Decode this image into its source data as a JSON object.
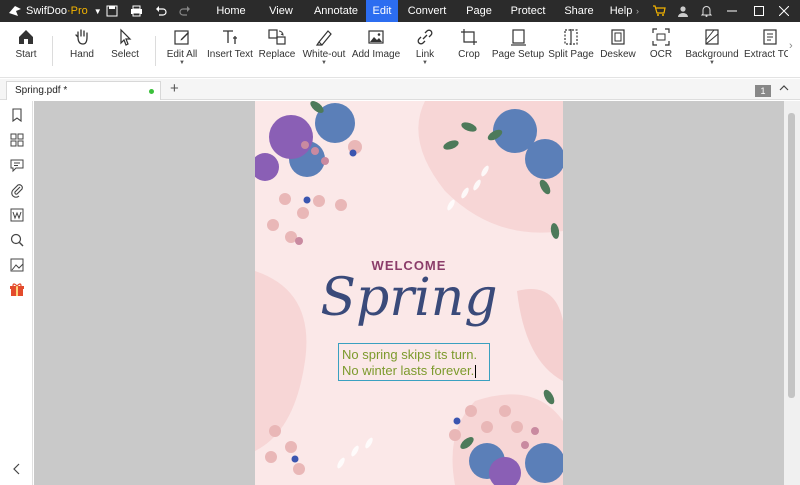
{
  "app": {
    "name": "SwifDoo",
    "name_suffix": "·Pro"
  },
  "menu": [
    "Home",
    "View",
    "Annotate",
    "Edit",
    "Convert",
    "Page",
    "Protect",
    "Share",
    "Help"
  ],
  "active_menu": "Edit",
  "tools": [
    "Start",
    "Hand",
    "Select",
    "Edit All",
    "Insert Text",
    "Replace",
    "White-out",
    "Add Image",
    "Link",
    "Crop",
    "Page Setup",
    "Split Page",
    "Deskew",
    "OCR",
    "Background",
    "Extract TO"
  ],
  "document": {
    "tab_name": "Spring.pdf *",
    "page_number": "1",
    "welcome": "WELCOME",
    "title": "Spring",
    "line1": "No spring skips its turn.",
    "line2": "No winter lasts forever."
  },
  "colors": {
    "accent": "#2c6df0",
    "titlebar": "#2b2b2b",
    "page_bg": "#fbe8e8",
    "welcome": "#8b3d6a",
    "spring": "#3a4a7a",
    "text_green": "#7c9a2c"
  }
}
